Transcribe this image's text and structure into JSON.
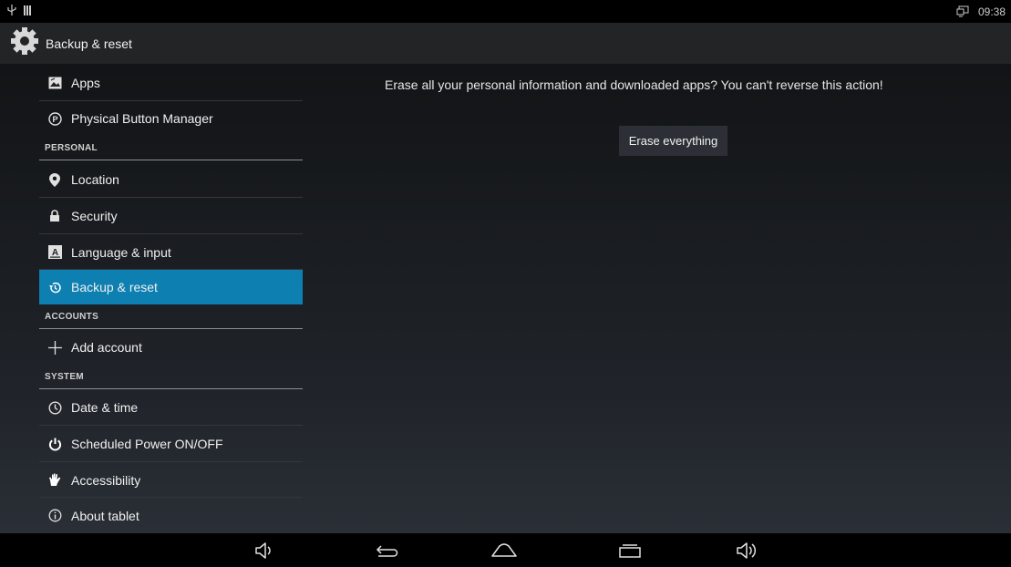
{
  "status_bar": {
    "time": "09:38",
    "left_icons": [
      "usb-icon",
      "signal-icon"
    ],
    "right_icons": [
      "screen-icon"
    ]
  },
  "action_bar": {
    "title": "Backup & reset",
    "icon": "gear-icon"
  },
  "sidebar": {
    "items": [
      {
        "label": "Apps",
        "icon": "image-icon"
      },
      {
        "label": "Physical Button Manager",
        "icon": "p-circle-icon"
      },
      {
        "label": "Location",
        "icon": "location-pin-icon"
      },
      {
        "label": "Security",
        "icon": "lock-icon"
      },
      {
        "label": "Language & input",
        "icon": "keyboard-a-icon"
      },
      {
        "label": "Backup & reset",
        "icon": "restore-icon",
        "selected": true
      },
      {
        "label": "Add account",
        "icon": "plus-icon"
      },
      {
        "label": "Date & time",
        "icon": "clock-icon"
      },
      {
        "label": "Scheduled Power ON/OFF",
        "icon": "power-icon"
      },
      {
        "label": "Accessibility",
        "icon": "hand-icon"
      },
      {
        "label": "About tablet",
        "icon": "info-icon"
      }
    ],
    "headers": {
      "personal": "PERSONAL",
      "accounts": "ACCOUNTS",
      "system": "SYSTEM"
    }
  },
  "main": {
    "message": "Erase all your personal information and downloaded apps? You can't reverse this action!",
    "button_label": "Erase everything"
  },
  "nav_bar": {
    "buttons": [
      "volume-down-icon",
      "back-icon",
      "home-icon",
      "recents-icon",
      "volume-up-icon"
    ]
  },
  "colors": {
    "selected": "#0d7fb0",
    "background": "#1a1d21"
  }
}
